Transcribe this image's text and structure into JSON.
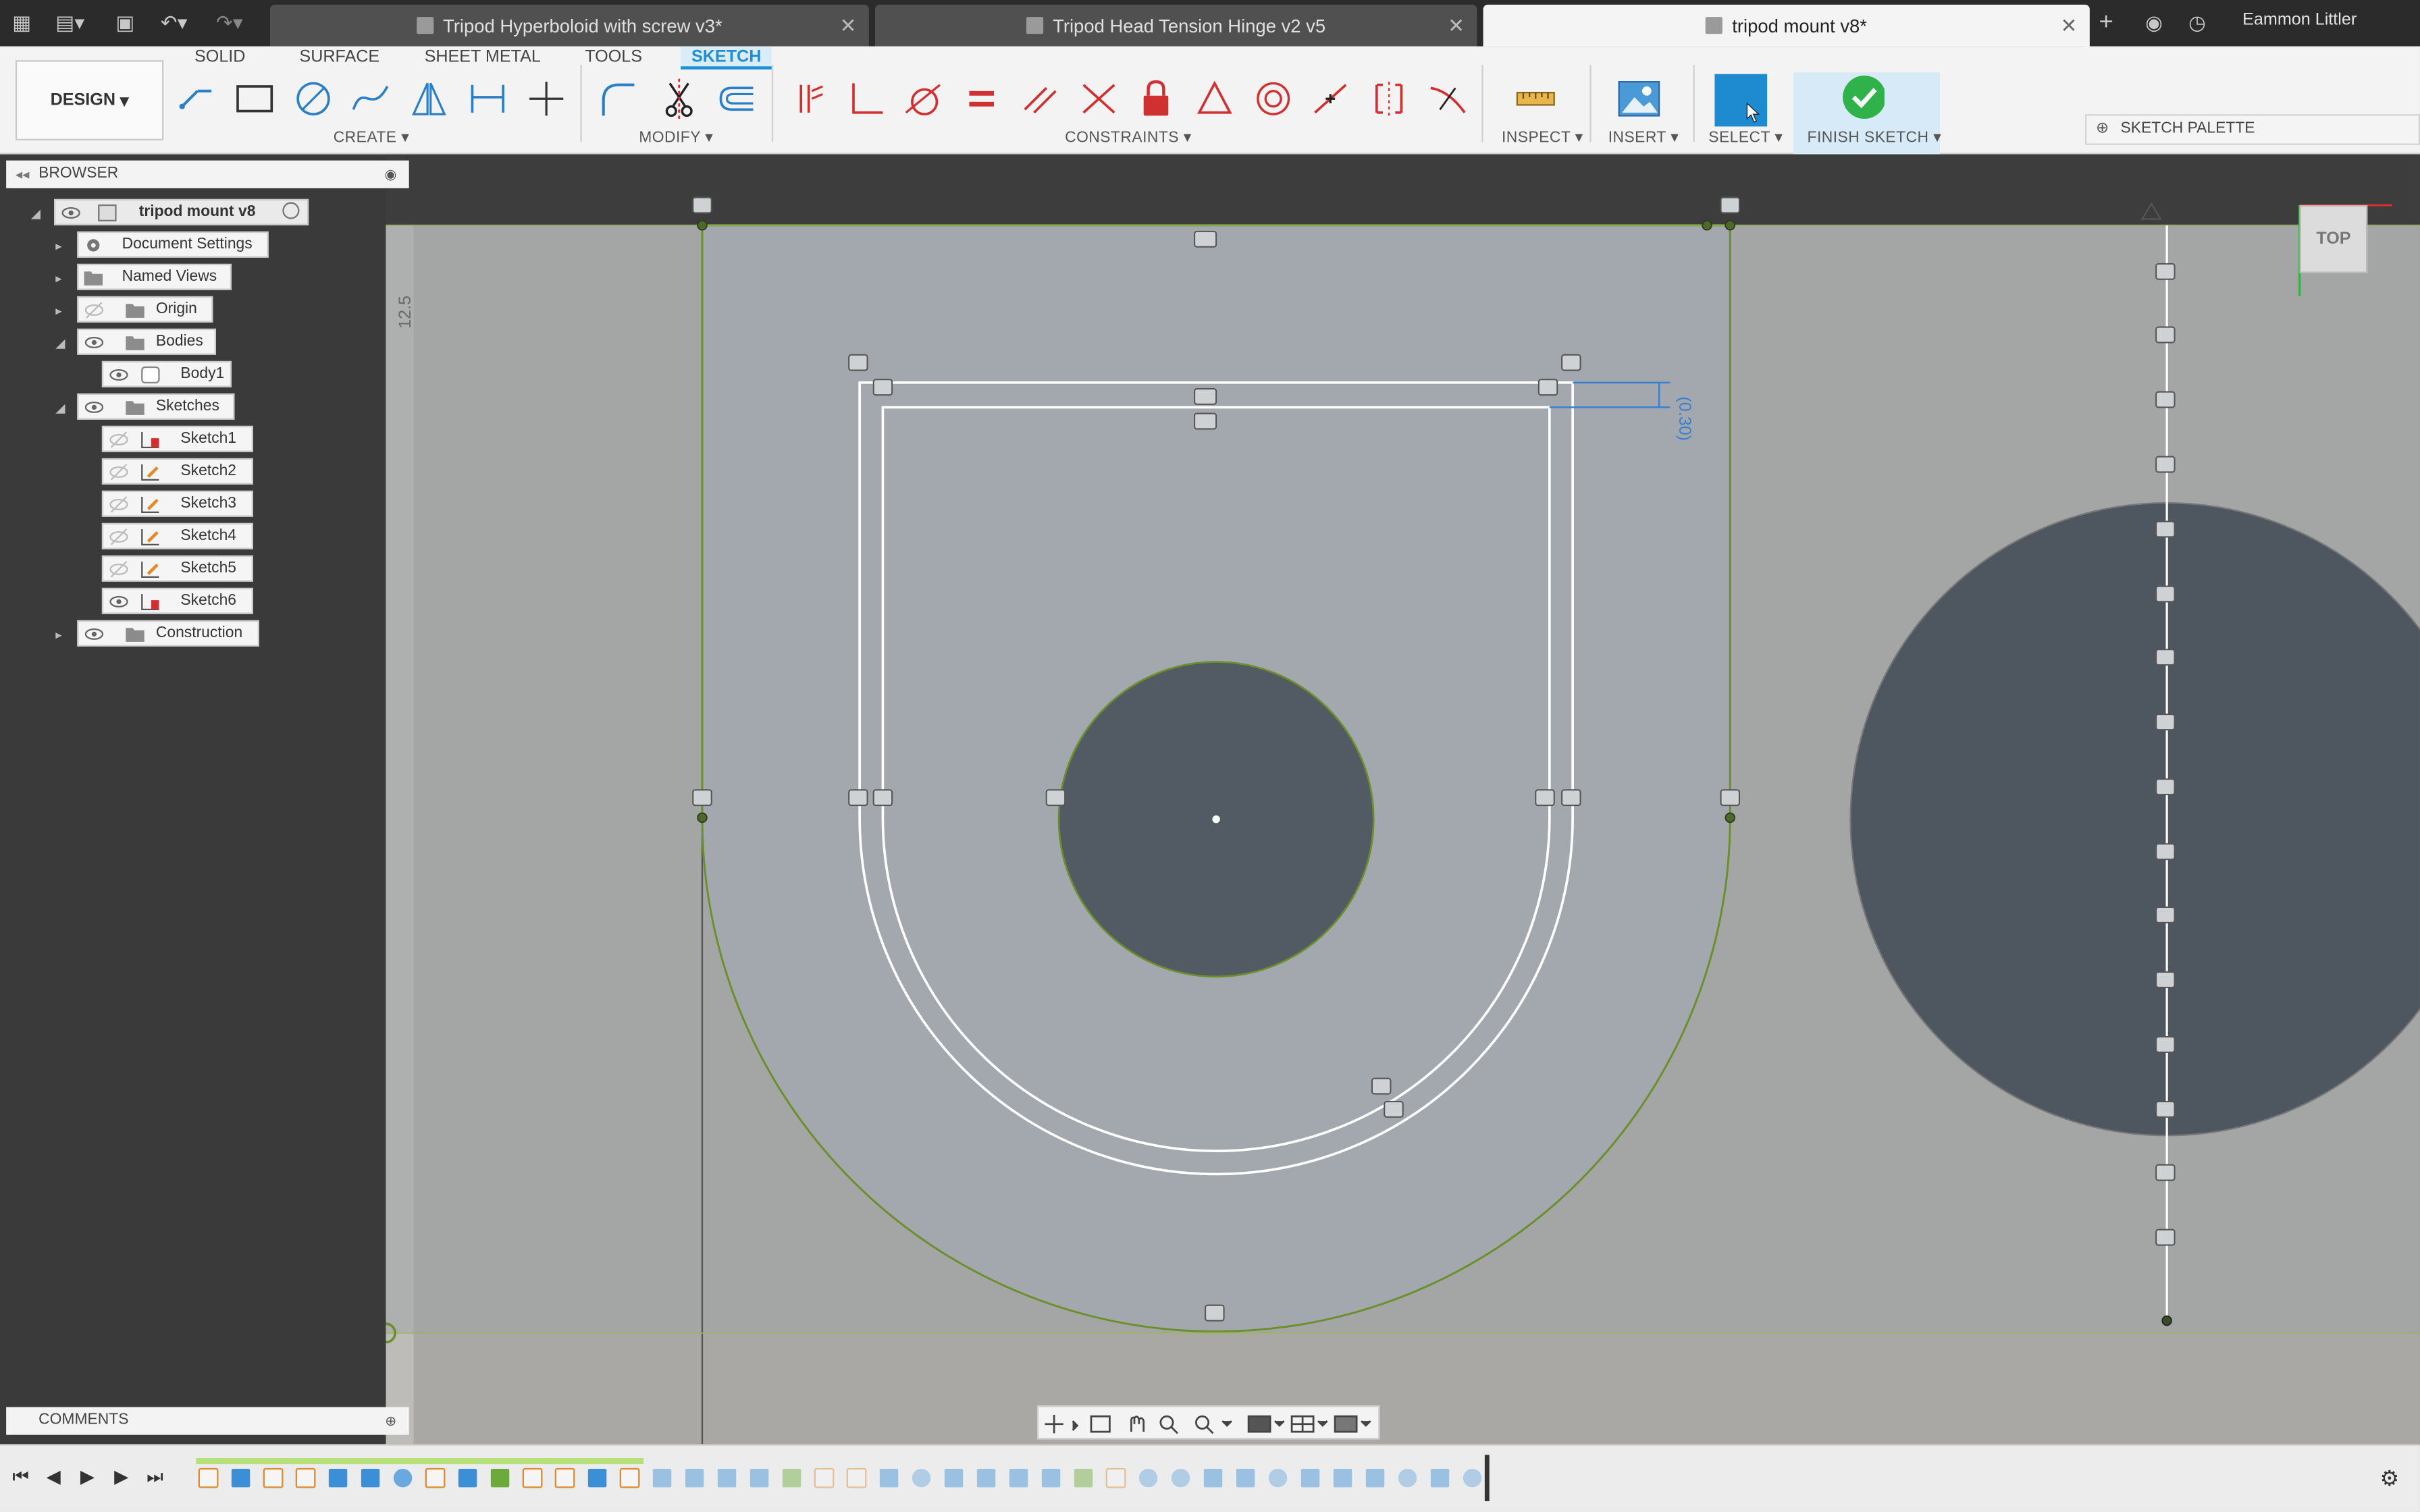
{
  "tabs": [
    {
      "title": "Tripod Hyperboloid with screw v3*",
      "active": false
    },
    {
      "title": "Tripod Head Tension Hinge v2 v5",
      "active": false
    },
    {
      "title": "tripod mount v8*",
      "active": true
    }
  ],
  "user_name": "Eammon Littler",
  "workspace_button": "DESIGN",
  "workspace_tabs": [
    "SOLID",
    "SURFACE",
    "SHEET METAL",
    "TOOLS",
    "SKETCH"
  ],
  "active_workspace_tab": "SKETCH",
  "tool_groups": {
    "create": "CREATE",
    "modify": "MODIFY",
    "constraints": "CONSTRAINTS",
    "inspect": "INSPECT",
    "insert": "INSERT",
    "select": "SELECT",
    "finish": "FINISH SKETCH"
  },
  "sketch_palette": "SKETCH PALETTE",
  "browser": {
    "title": "BROWSER",
    "root": "tripod mount v8",
    "items": [
      {
        "label": "Document Settings",
        "icon": "gear-icon"
      },
      {
        "label": "Named Views",
        "icon": "folder-icon"
      },
      {
        "label": "Origin",
        "icon": "folder-icon"
      },
      {
        "label": "Bodies",
        "icon": "folder-icon"
      },
      {
        "label": "Body1",
        "icon": "body-icon"
      },
      {
        "label": "Sketches",
        "icon": "folder-icon"
      },
      {
        "label": "Sketch1",
        "icon": "sketch-icon"
      },
      {
        "label": "Sketch2",
        "icon": "sketch-icon"
      },
      {
        "label": "Sketch3",
        "icon": "sketch-icon"
      },
      {
        "label": "Sketch4",
        "icon": "sketch-icon"
      },
      {
        "label": "Sketch5",
        "icon": "sketch-icon"
      },
      {
        "label": "Sketch6",
        "icon": "sketch-icon"
      },
      {
        "label": "Construction",
        "icon": "folder-icon"
      }
    ]
  },
  "comments_label": "COMMENTS",
  "viewcube_label": "TOP",
  "ruler_label": "12.5",
  "dimension_label": "(0.30)",
  "colors": {
    "accent": "#1f8fd1",
    "sketch_line": "#ffffff",
    "profile_edge": "#6b8f2a",
    "canvas_bg": "#a8a7a3",
    "sketch_fill": "#8f949a",
    "hole_fill": "#4f5861"
  }
}
